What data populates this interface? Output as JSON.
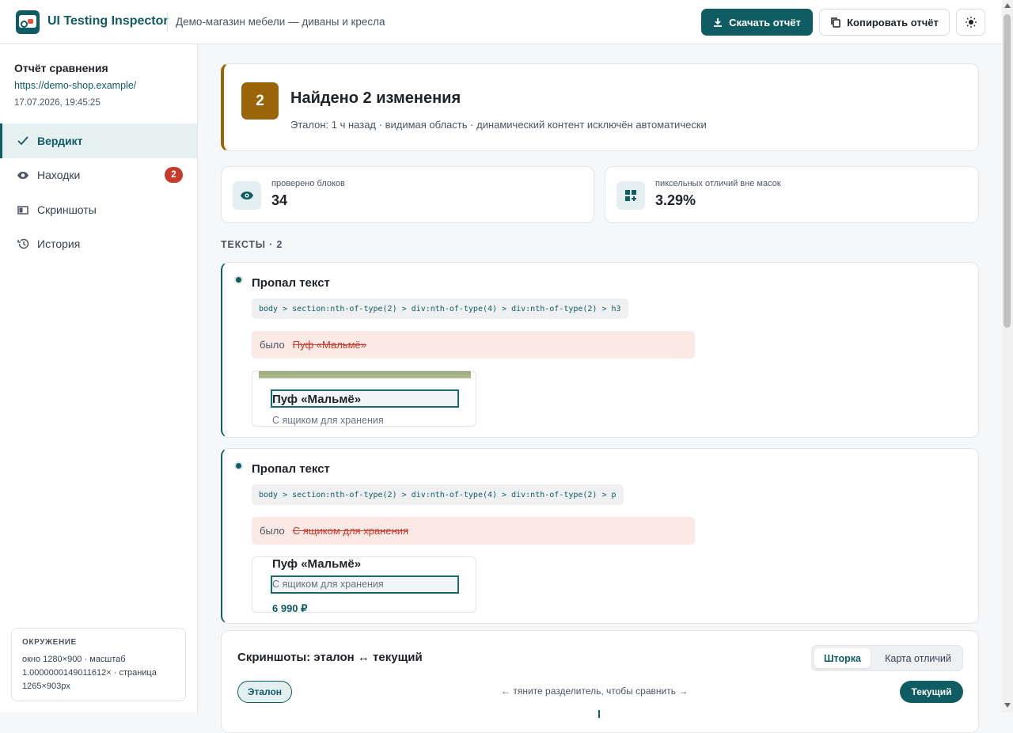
{
  "header": {
    "app_name": "UI Testing Inspector",
    "project": "Демо-магазин мебели — диваны и кресла",
    "download_label": "Скачать отчёт",
    "copy_label": "Копировать отчёт",
    "theme_icon": "sun-icon"
  },
  "sidebar": {
    "title": "Отчёт сравнения",
    "url": "https://demo-shop.example/",
    "date": "17.07.2026, 19:45:25",
    "nav": [
      {
        "label": "Вердикт",
        "icon": "check-icon",
        "active": true
      },
      {
        "label": "Находки",
        "icon": "eye-icon",
        "badge": "2"
      },
      {
        "label": "Скриншоты",
        "icon": "screenshot-icon"
      },
      {
        "label": "История",
        "icon": "history-icon"
      }
    ],
    "env_title": "ОКРУЖЕНИЕ",
    "env_text": "окно 1280×900 · масштаб 1.0000000149011612× · страница 1265×903px"
  },
  "verdict": {
    "count": "2",
    "title": "Найдено 2 изменения",
    "subtitle": "Эталон: 1 ч назад · видимая область · динамический контент исключён автоматически"
  },
  "stats": [
    {
      "label": "проверено блоков",
      "value": "34",
      "icon": "eye-icon"
    },
    {
      "label": "пиксельных отличий вне масок",
      "value": "3.29%",
      "icon": "dashboard-icon"
    }
  ],
  "section_title": "ТЕКСТЫ · 2",
  "findings": [
    {
      "title": "Пропал текст",
      "selector": "body > section:nth-of-type(2) > div:nth-of-type(4) > div:nth-of-type(2) > h3",
      "was_label": "было",
      "was_value": "Пуф «Мальмё»",
      "thumb_heading": "Пуф «Мальмё»",
      "thumb_text": "С ящиком для хранения"
    },
    {
      "title": "Пропал текст",
      "selector": "body > section:nth-of-type(2) > div:nth-of-type(4) > div:nth-of-type(2) > p",
      "was_label": "было",
      "was_value": "С ящиком для хранения",
      "thumb_heading": "Пуф «Мальмё»",
      "thumb_text": "С ящиком для хранения",
      "thumb_price": "6 990 ₽"
    }
  ],
  "screenshots": {
    "title": "Скриншоты: эталон ↔ текущий",
    "tab_curtain": "Шторка",
    "tab_diff": "Карта отличий",
    "baseline_label": "Эталон",
    "hint": "← тяните разделитель, чтобы сравнить →",
    "current_label": "Текущий"
  },
  "colors": {
    "accent": "#0f5c63",
    "warning": "#9a6507",
    "danger": "#c53b2c"
  }
}
